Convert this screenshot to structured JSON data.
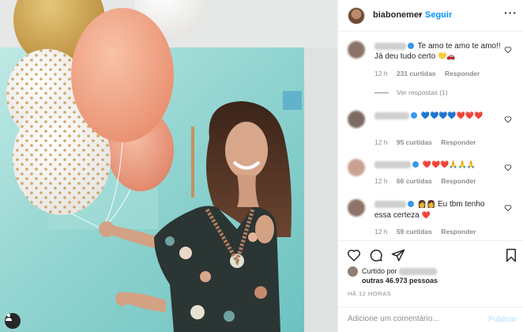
{
  "post": {
    "username": "biabonemer",
    "dot": "•",
    "follow_label": "Seguir",
    "more_label": "···"
  },
  "comments": [
    {
      "text": "Te amo te amo te amo!! Já deu tudo certo",
      "emoji": "💛🚗",
      "time": "12 h",
      "likes": "231 curtidas",
      "reply": "Responder"
    },
    {
      "text": "",
      "emoji": "💙💙💙💙❤️❤️❤️",
      "time": "12 h",
      "likes": "95 curtidas",
      "reply": "Responder"
    },
    {
      "text": "",
      "emoji": "❤️❤️❤️🙏🙏🙏",
      "time": "12 h",
      "likes": "66 curtidas",
      "reply": "Responder"
    },
    {
      "text": "Eu tbm tenho essa certeza",
      "emoji_pre": "👩👩",
      "emoji": "❤️",
      "time": "12 h",
      "likes": "59 curtidas",
      "reply": "Responder"
    }
  ],
  "view_replies": "Ver respostas (1)",
  "liked_by_prefix": "Curtido por",
  "liked_by_others": "outras 46.973 pessoas",
  "time_ago": "HÁ 12 HORAS",
  "comment_placeholder": "Adicione um comentário...",
  "publish_label": "Publicar",
  "icons": {
    "like": "heart-icon",
    "comment": "comment-icon",
    "share": "share-icon",
    "save": "bookmark-icon",
    "tag": "user-tag-icon"
  },
  "colors": {
    "accent": "#0095f6",
    "publish_disabled": "#b2dffc",
    "muted": "#8e8e8e",
    "text": "#262626"
  }
}
